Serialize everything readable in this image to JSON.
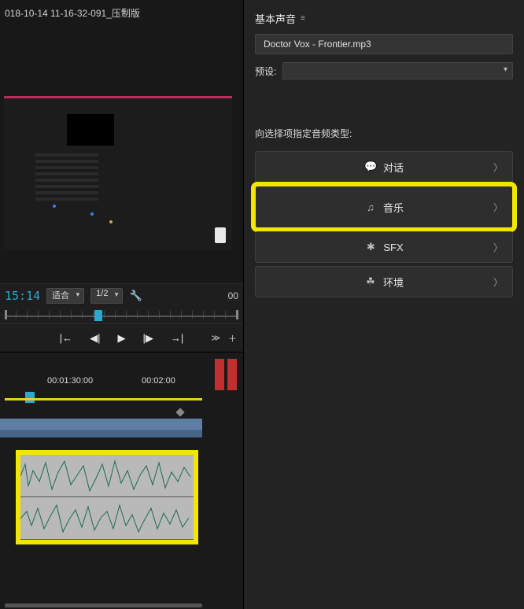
{
  "program_monitor": {
    "clip_title": "018-10-14 11-16-32-091_压制版",
    "timecode": "15:14",
    "fit_label": "适合",
    "res_label": "1/2",
    "right_num": "00",
    "transport": [
      "|←",
      "◀|",
      "▶",
      "|▶",
      "→|"
    ],
    "tail_more": "≫",
    "tail_plus": "＋"
  },
  "timeline": {
    "tc1": "00:01:30:00",
    "tc2": "00:02:00"
  },
  "essential_sound": {
    "title": "基本声音",
    "filename": "Doctor Vox - Frontier.mp3",
    "preset_label": "预设:",
    "assign_label": "向选择项指定音频类型:",
    "types": [
      {
        "icon": "💬",
        "label": "对话"
      },
      {
        "icon": "♫",
        "label": "音乐"
      },
      {
        "icon": "✱",
        "label": "SFX"
      },
      {
        "icon": "☘",
        "label": "环境"
      }
    ]
  }
}
